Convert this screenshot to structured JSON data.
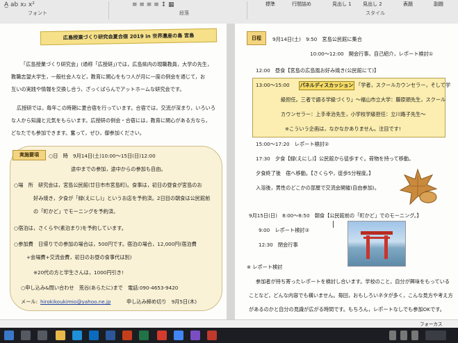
{
  "ribbon": {
    "group_font": "フォント",
    "group_paragraph": "段落",
    "group_style": "スタイル",
    "style_standard": "標準",
    "style_nospacing": "行間詰め",
    "style_heading1": "見出し 1",
    "style_heading2": "見出し 2",
    "style_title": "表題",
    "style_subtitle": "副題"
  },
  "left_page": {
    "title": "広島授業づくり研究会夏合宿 2019 in 世界遺産の島 宮島",
    "intro": [
      "「広島授業づくり研究会」(通称「広授研」)では，広島県内の現職教員，大学の先生，",
      "教職志望大学生，一般社会人など，教育に関心をもつ人が月に一度の例会を通じて，お",
      "互いの実践や情報を交換し合う，ざっくばらんでアットホームな研究会です。",
      "広授研では，毎年この時期に夏合宿を行っています。合宿では，交流が深まり，いろいろ",
      "な人から知識と元気をもらいます。広授研の例会・合宿には，教育に関心がある方なら，",
      "どなたでも参加できます。奮って，ぜひ，御参加ください。"
    ],
    "tag": "実施要項",
    "details": [
      "○日　時　9月14日(土)10:00〜15日(日)12:00",
      "途中までの参加，途中からの参加も自由。",
      "○場　所　研究会は，宮島公民館(廿日市市宮島町)。食事は，初日の昼食が宮島のお",
      "好み焼き，夕食が「緑(えにし)」というお店を予約済。2日目の朝食は公民館前",
      "の「町かど」でモーニングを予約済。",
      "○宿泊は，さくらや(素泊まり)を予約しています。",
      "○参加費　日帰りでの参加の場合は，500円です。宿泊の場合，12,000円(宿泊費",
      "+会場費+交流会費，初日のお昼の食事代は別)",
      "※20代の方と学生さんは，1000円引き!",
      "○申し込み&問い合わせ　荒谷(あらたに)まで　電話:090-4653-9420",
      "メール:",
      "hirokikoukimio@yahoo.ne.jp",
      "申し込み締め切り　9月5日(木)"
    ]
  },
  "right_page": {
    "tag": "日程",
    "schedule_day1": [
      "9月14日(土)　9:50　宮島公民館に集合",
      "10:00〜12:00　開会行事，自己紹介，レポート検討①",
      "12:00　昼食【宮島の広島風お好み焼き(公民館にて)】"
    ],
    "panel_time": "13:00〜15:00",
    "panel_tag": "パネルディスカッション",
    "panel_lines": [
      "「学者，スクールカウンセラー，そして学",
      "級担任。三者で語る学級づくり」〜福山市立大学：藤原頭先生，スクール",
      "カウンセラー：上手幸治先生，小学校学級担任：立川路子先生〜",
      "※こういう企画は，なかなかありません。注目です!"
    ],
    "schedule_day1b": [
      "15:00〜17:20　レポート検討②",
      "17:30　夕食【緑(えにし)】公民館から徒歩すぐ。荷物を持って移動。",
      "夕食終了後　宿へ移動。【さくらや，徒歩5分程度。】",
      "入浴後，男性のどこかの部屋で交流会開催(自由参加)。"
    ],
    "schedule_day2": [
      "9月15日(日)　8:00〜8:50　朝食【公民館前の「町かど」でのモーニング。】",
      "9:00　レポート検討③",
      "12:30　閉会行事"
    ],
    "report_heading": "※ レポート検討",
    "report_lines": [
      "参加者が持ち寄ったレポートを検討し合います。学校のこと，自分が興味をもっている",
      "ことなど，どんな内容でも構いません。毎回，おもしろいネタが多く，こんな見方や考え方",
      "があるのかと自分の見識が広がる時間です。もちろん，レポートなしでも参加OKです。"
    ]
  },
  "statusbar": {
    "focus": "フォーカス"
  }
}
